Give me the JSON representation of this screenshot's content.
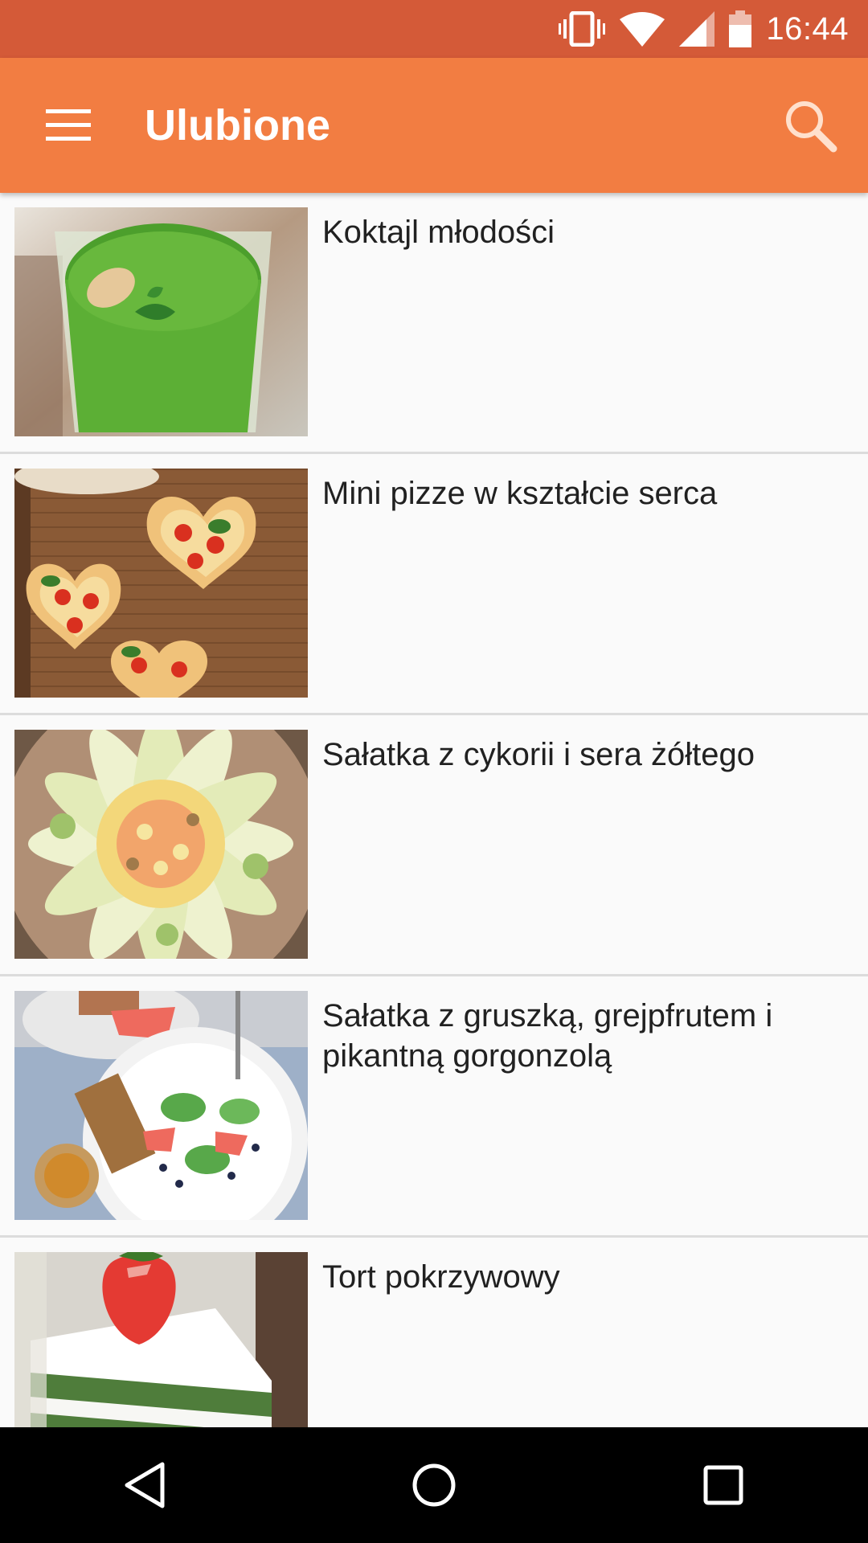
{
  "status_bar": {
    "time": "16:44",
    "icons": [
      "vibrate-icon",
      "wifi-icon",
      "cell-signal-icon",
      "battery-icon"
    ],
    "background": "#d45a38"
  },
  "app_bar": {
    "title": "Ulubione",
    "menu_icon": "hamburger-menu-icon",
    "search_icon": "search-icon",
    "background": "#f27d42"
  },
  "favorites": [
    {
      "title": "Koktajl młodości",
      "image": "green-smoothie-photo"
    },
    {
      "title": "Mini pizze w kształcie serca",
      "image": "heart-pizzas-photo"
    },
    {
      "title": "Sałatka z cykorii i sera żółtego",
      "image": "chicory-salad-photo"
    },
    {
      "title": "Sałatka z gruszką, grejpfrutem i pikantną gorgonzolą",
      "image": "pear-grapefruit-salad-photo"
    },
    {
      "title": "Tort pokrzywowy",
      "image": "nettle-cake-photo"
    }
  ],
  "nav_bar": {
    "icons": [
      "back-icon",
      "home-icon",
      "recents-icon"
    ]
  }
}
